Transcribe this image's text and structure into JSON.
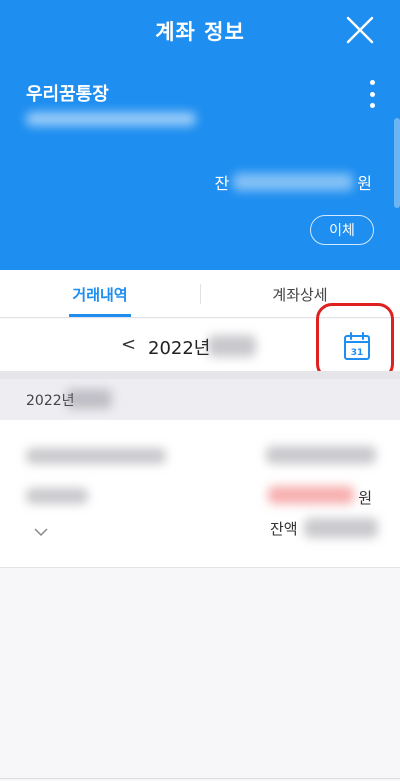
{
  "header": {
    "title": "계좌 정보",
    "account_name": "우리꿈통장",
    "balance_prefix": "잔",
    "balance_unit": "원",
    "transfer_label": "이체"
  },
  "tabs": [
    {
      "label": "거래내역",
      "active": true
    },
    {
      "label": "계좌상세",
      "active": false
    }
  ],
  "month_nav": {
    "prev": "<",
    "year_label": "2022년",
    "calendar_day": "31"
  },
  "date_group": {
    "label": "2022년"
  },
  "transaction": {
    "amount_unit": "원",
    "balance_label": "잔액"
  },
  "colors": {
    "primary": "#1e8ef0",
    "highlight": "#e0201f"
  }
}
